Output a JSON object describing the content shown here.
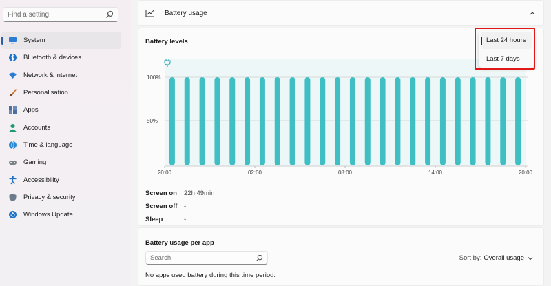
{
  "search": {
    "placeholder": "Find a setting"
  },
  "sidebar": {
    "items": [
      {
        "label": "System",
        "icon": "system-icon",
        "active": true
      },
      {
        "label": "Bluetooth & devices",
        "icon": "bluetooth-icon"
      },
      {
        "label": "Network & internet",
        "icon": "wifi-icon"
      },
      {
        "label": "Personalisation",
        "icon": "brush-icon"
      },
      {
        "label": "Apps",
        "icon": "apps-icon"
      },
      {
        "label": "Accounts",
        "icon": "person-icon"
      },
      {
        "label": "Time & language",
        "icon": "globe-icon"
      },
      {
        "label": "Gaming",
        "icon": "gamepad-icon"
      },
      {
        "label": "Accessibility",
        "icon": "accessibility-icon"
      },
      {
        "label": "Privacy & security",
        "icon": "shield-icon"
      },
      {
        "label": "Windows Update",
        "icon": "update-icon"
      }
    ]
  },
  "header": {
    "title": "Battery usage"
  },
  "levels": {
    "title": "Battery levels"
  },
  "dropdown": {
    "options": [
      "Last 24 hours",
      "Last 7 days"
    ],
    "selected": "Last 24 hours"
  },
  "chart_data": {
    "type": "bar",
    "x_ticks": [
      "20:00",
      "02:00",
      "08:00",
      "14:00",
      "20:00"
    ],
    "y_ticks": [
      "100%",
      "50%"
    ],
    "values": [
      100,
      100,
      100,
      100,
      100,
      100,
      100,
      100,
      100,
      100,
      100,
      100,
      100,
      100,
      100,
      100,
      100,
      100,
      100,
      100,
      100,
      100,
      100,
      100
    ],
    "ylim": [
      0,
      100
    ],
    "bar_color": "#3fbfc4",
    "grid": true
  },
  "stats": [
    {
      "label": "Screen on",
      "value": "22h 49min"
    },
    {
      "label": "Screen off",
      "value": "-"
    },
    {
      "label": "Sleep",
      "value": "-"
    }
  ],
  "per_app": {
    "title": "Battery usage per app",
    "search_placeholder": "Search",
    "sort_label": "Sort by:",
    "sort_value": "Overall usage",
    "empty_message": "No apps used battery during this time period."
  },
  "colors": {
    "accent": "#2c5ea6",
    "highlight": "#e01818",
    "bar": "#3fbfc4",
    "plug": "#1fa3b0"
  }
}
